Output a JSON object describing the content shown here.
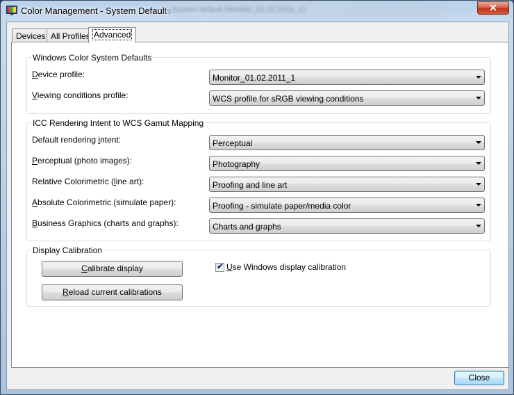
{
  "window": {
    "title": "Color Management - System Defaults",
    "blurred_title_text": "System default (Monitor_01.02.2011_1)",
    "close_glyph": "✕"
  },
  "tabs": [
    {
      "label": "Devices"
    },
    {
      "label": "All Profiles"
    },
    {
      "label": "Advanced"
    }
  ],
  "wcs_defaults": {
    "title": "Windows Color System Defaults",
    "device_profile": {
      "label_u": "D",
      "label_rest": "evice profile:",
      "value": "Monitor_01.02.2011_1"
    },
    "viewing_conditions": {
      "label_u": "V",
      "label_rest": "iewing conditions profile:",
      "value": "WCS profile for sRGB viewing conditions"
    }
  },
  "icc_mapping": {
    "title": "ICC Rendering Intent to WCS Gamut Mapping",
    "default_intent": {
      "label_pre": "Default rendering ",
      "label_u": "i",
      "label_post": "ntent:",
      "value": "Perceptual"
    },
    "perceptual": {
      "label_pre": "",
      "label_u": "P",
      "label_post": "erceptual (photo images):",
      "value": "Photography"
    },
    "relative": {
      "label_pre": "Relative Colorimetric (",
      "label_u": "l",
      "label_post": "ine art):",
      "value": "Proofing and line art"
    },
    "absolute": {
      "label_pre": "",
      "label_u": "A",
      "label_post": "bsolute Colorimetric (simulate paper):",
      "value": "Proofing - simulate paper/media color"
    },
    "business": {
      "label_pre": "",
      "label_u": "B",
      "label_post": "usiness Graphics (charts and graphs):",
      "value": "Charts and graphs"
    }
  },
  "calibration": {
    "title": "Display Calibration",
    "calibrate_button": {
      "u": "C",
      "rest": "alibrate display"
    },
    "reload_button": {
      "u": "R",
      "rest": "eload current calibrations"
    },
    "use_windows_calibration": {
      "u": "U",
      "rest": "se Windows display calibration",
      "checked": true,
      "check_glyph": "✔"
    }
  },
  "footer": {
    "close_button": "Close"
  }
}
